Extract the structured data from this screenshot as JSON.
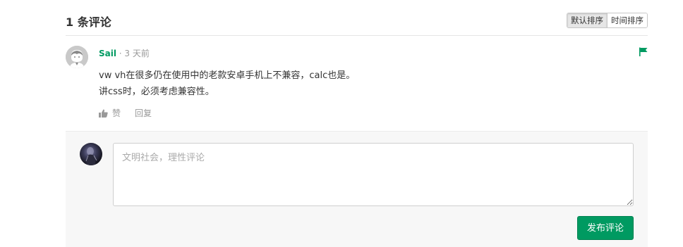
{
  "header": {
    "title": "1 条评论",
    "sort_options": [
      {
        "label": "默认排序",
        "active": true
      },
      {
        "label": "时间排序",
        "active": false
      }
    ]
  },
  "comment": {
    "author": "Sail",
    "separator": " · ",
    "time": "3 天前",
    "lines": [
      "vw vh在很多仍在使用中的老款安卓手机上不兼容，calc也是。",
      "讲css时，必须考虑兼容性。"
    ],
    "like_label": "赞",
    "reply_label": "回复",
    "flag_icon": "flag-icon",
    "like_icon": "thumbs-up-icon"
  },
  "reply_box": {
    "placeholder": "文明社会，理性评论",
    "submit_label": "发布评论"
  },
  "colors": {
    "accent": "#009a61",
    "muted": "#999999",
    "reply_bg": "#f7f7f7"
  }
}
